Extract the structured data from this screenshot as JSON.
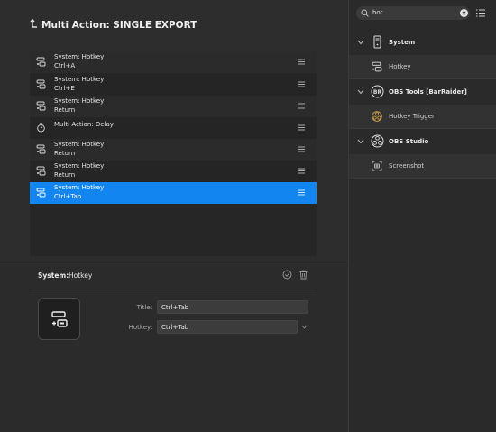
{
  "header": {
    "title": "Multi Action: SINGLE EXPORT",
    "back_icon": "back-arrow-icon"
  },
  "actions": [
    {
      "line1": "System: Hotkey",
      "line2": "Ctrl+A",
      "icon": "hotkey-icon",
      "selected": false
    },
    {
      "line1": "System: Hotkey",
      "line2": "Ctrl+E",
      "icon": "hotkey-icon",
      "selected": false
    },
    {
      "line1": "System: Hotkey",
      "line2": "Return",
      "icon": "hotkey-icon",
      "selected": false
    },
    {
      "line1": "Multi Action: Delay",
      "line2": "",
      "icon": "timer-icon",
      "selected": false
    },
    {
      "line1": "System: Hotkey",
      "line2": "Return",
      "icon": "hotkey-icon",
      "selected": false
    },
    {
      "line1": "System: Hotkey",
      "line2": "Return",
      "icon": "hotkey-icon",
      "selected": false
    },
    {
      "line1": "System: Hotkey",
      "line2": "Ctrl+Tab",
      "icon": "hotkey-icon",
      "selected": true
    }
  ],
  "inspector": {
    "category": "System:",
    "name": "Hotkey",
    "title_label": "Title:",
    "title_value": "Ctrl+Tab",
    "hotkey_label": "Hotkey:",
    "hotkey_value": "Ctrl+Tab"
  },
  "search": {
    "value": "hot"
  },
  "library": {
    "categories": [
      {
        "label": "System",
        "icon": "system-icon",
        "items": [
          {
            "label": "Hotkey",
            "icon": "hotkey-icon"
          }
        ]
      },
      {
        "label": "OBS Tools [BarRaider]",
        "icon": "barraider-icon",
        "items": [
          {
            "label": "Hotkey Trigger",
            "icon": "obs-icon"
          }
        ]
      },
      {
        "label": "OBS Studio",
        "icon": "obs-icon",
        "items": [
          {
            "label": "Screenshot",
            "icon": "screenshot-icon"
          }
        ]
      }
    ]
  },
  "colors": {
    "accent": "#1285f0",
    "background": "#2d2d2d"
  }
}
